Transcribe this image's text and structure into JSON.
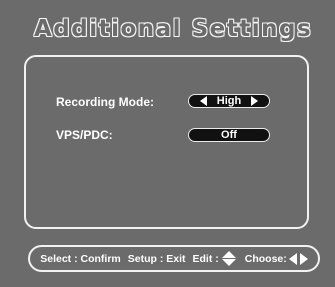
{
  "title": "Additional Settings",
  "settings": [
    {
      "label": "Recording Mode:",
      "value": "High",
      "has_arrows": true
    },
    {
      "label": "VPS/PDC:",
      "value": "Off",
      "has_arrows": false
    }
  ],
  "footer": {
    "select": "Select : Confirm",
    "setup": "Setup : Exit",
    "edit": "Edit :",
    "choose": "Choose:"
  },
  "icons": {
    "left": "left-triangle",
    "right": "right-triangle",
    "updown": "up-down-arrows"
  },
  "colors": {
    "background": "#6b6b6b",
    "outline": "#f2f2f2",
    "pill": "#111111"
  }
}
